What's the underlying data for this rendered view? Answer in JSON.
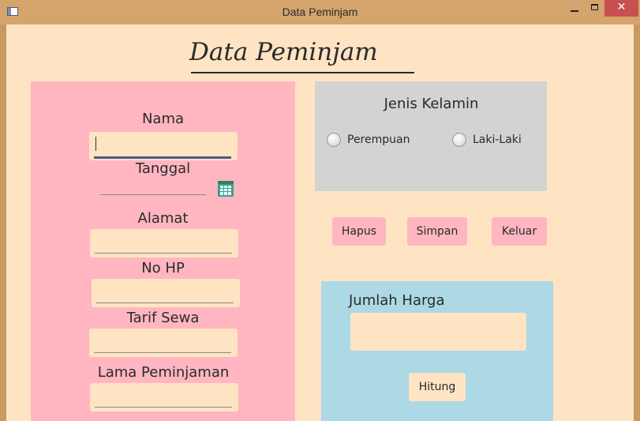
{
  "window": {
    "title": "Data Peminjam",
    "minimize_glyph": "",
    "close_glyph": "✕"
  },
  "form": {
    "heading": "Data Peminjam",
    "nama": {
      "label": "Nama",
      "value": ""
    },
    "tanggal": {
      "label": "Tanggal",
      "value": "",
      "icon": "calendar-icon"
    },
    "alamat": {
      "label": "Alamat",
      "value": ""
    },
    "no_hp": {
      "label": "No HP",
      "value": ""
    },
    "tarif_sewa": {
      "label": "Tarif Sewa",
      "value": ""
    },
    "lama_peminjaman": {
      "label": "Lama Peminjaman",
      "value": ""
    }
  },
  "gender": {
    "title": "Jenis Kelamin",
    "options": [
      {
        "label": "Perempuan",
        "selected": false
      },
      {
        "label": "Laki-Laki",
        "selected": false
      }
    ]
  },
  "actions": {
    "hapus": "Hapus",
    "simpan": "Simpan",
    "keluar": "Keluar"
  },
  "total": {
    "label": "Jumlah Harga",
    "value": "",
    "hitung": "Hitung"
  },
  "colors": {
    "background": "#ffe4c4",
    "form_panel": "#ffb6c1",
    "gender_panel": "#d3d3d3",
    "total_panel": "#add8e6",
    "close_button": "#c75050"
  }
}
